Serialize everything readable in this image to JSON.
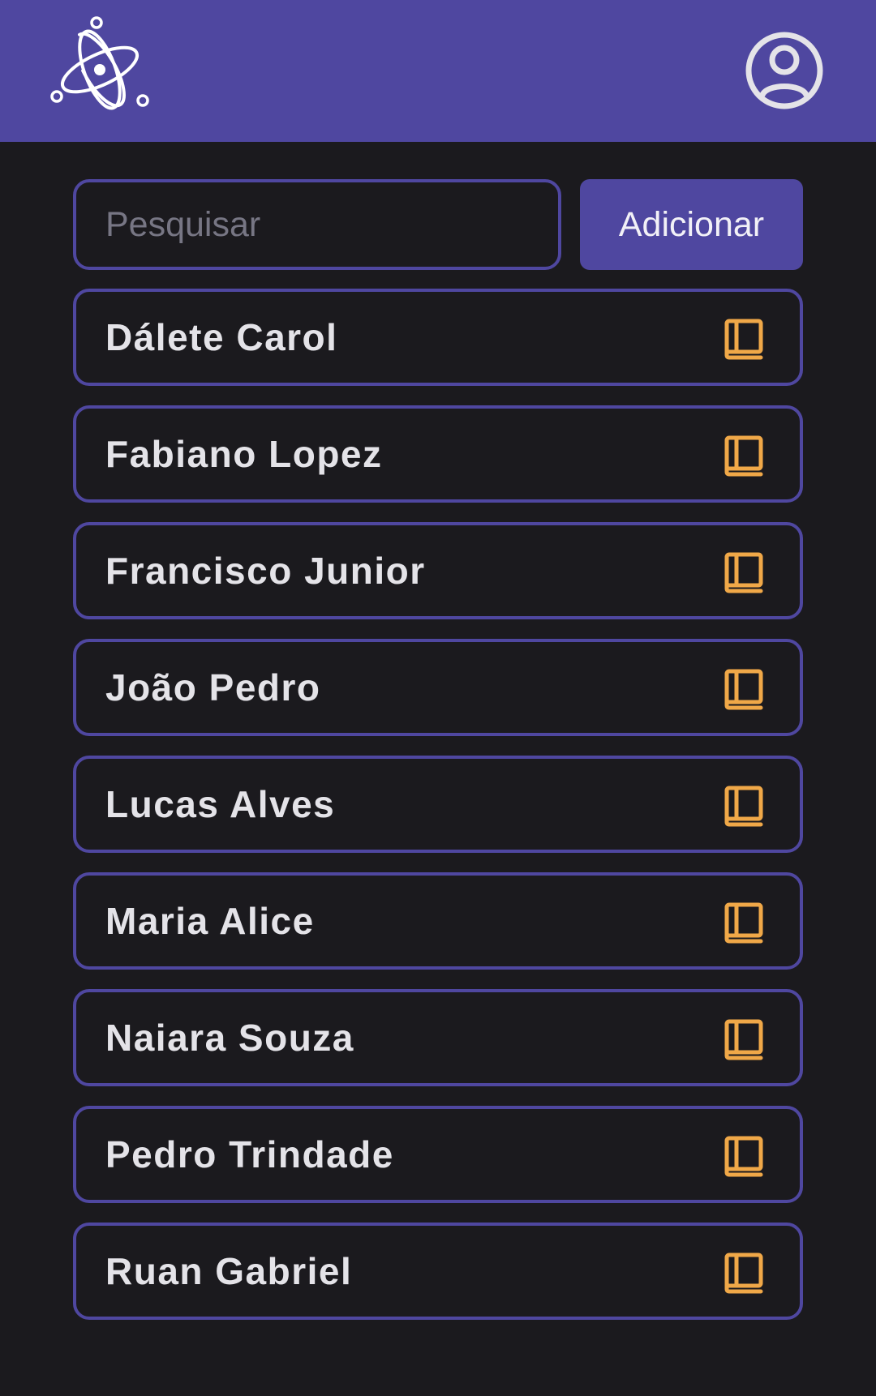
{
  "header": {
    "logo_icon": "atom-icon",
    "profile_icon": "user-circle-icon",
    "background": "#4f47a0"
  },
  "search": {
    "placeholder": "Pesquisar",
    "value": ""
  },
  "toolbar": {
    "add_label": "Adicionar"
  },
  "list": {
    "item_icon": "book-icon",
    "icon_color": "#f0a848",
    "items": [
      {
        "label": "Dálete Carol"
      },
      {
        "label": "Fabiano Lopez"
      },
      {
        "label": "Francisco Junior"
      },
      {
        "label": "João Pedro"
      },
      {
        "label": "Lucas Alves"
      },
      {
        "label": "Maria Alice"
      },
      {
        "label": "Naiara Souza"
      },
      {
        "label": "Pedro Trindade"
      },
      {
        "label": "Ruan Gabriel"
      }
    ]
  }
}
